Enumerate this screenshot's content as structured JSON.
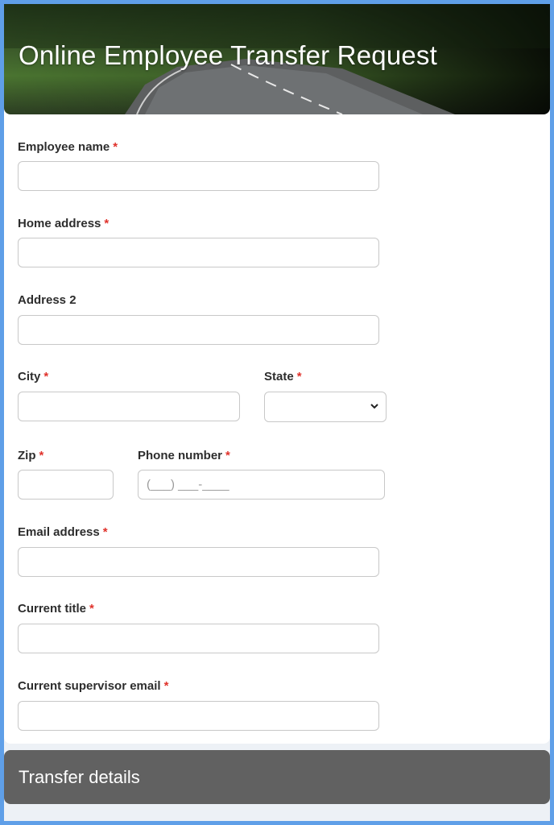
{
  "header": {
    "title": "Online Employee Transfer Request"
  },
  "fields": {
    "employee_name": {
      "label": "Employee name",
      "required": "*",
      "value": ""
    },
    "home_address": {
      "label": "Home address",
      "required": "*",
      "value": ""
    },
    "address2": {
      "label": "Address 2",
      "value": ""
    },
    "city": {
      "label": "City",
      "required": "*",
      "value": ""
    },
    "state": {
      "label": "State",
      "required": "*",
      "selected": ""
    },
    "zip": {
      "label": "Zip",
      "required": "*",
      "value": ""
    },
    "phone": {
      "label": "Phone number",
      "required": "*",
      "placeholder": "(___) ___-____"
    },
    "email": {
      "label": "Email address",
      "required": "*",
      "value": ""
    },
    "current_title": {
      "label": "Current title",
      "required": "*",
      "value": ""
    },
    "supervisor_email": {
      "label": "Current supervisor email",
      "required": "*",
      "value": ""
    }
  },
  "section": {
    "title": "Transfer details"
  },
  "colors": {
    "frame": "#5f9fe8",
    "section_bar": "#616161",
    "required": "#e0322b"
  }
}
